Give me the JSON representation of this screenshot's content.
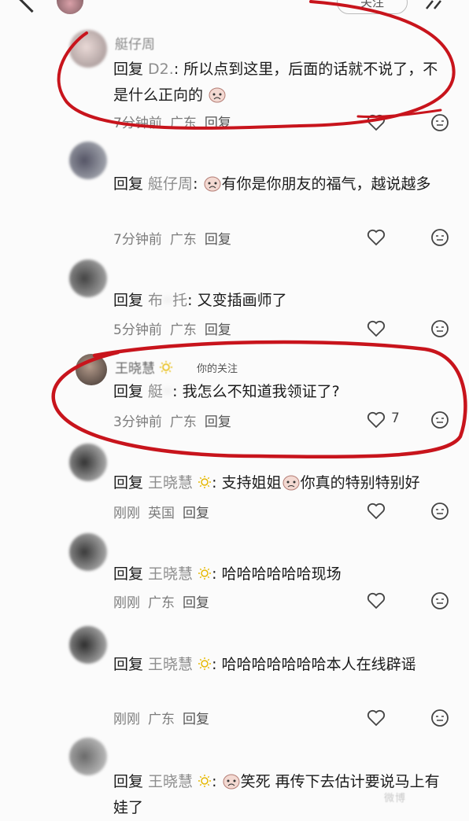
{
  "header": {
    "follow_label": "关注"
  },
  "comments": [
    {
      "username": "艇仔周",
      "text_prefix": "回复 ",
      "mention": "D2.",
      "colon": ": ",
      "body": "所以点到这里，后面的话就不说了，不是什么正向的",
      "time": "7分钟前",
      "location": "广东",
      "reply": "回复"
    },
    {
      "username": "",
      "text_prefix": "回复 ",
      "mention": "艇仔周",
      "colon": ": ",
      "body": "有你是你朋友的福气，越说越多",
      "time": "7分钟前",
      "location": "广东",
      "reply": "回复"
    },
    {
      "username": "",
      "text_prefix": "回复 ",
      "mention": "布",
      "mention2": "托",
      "colon": ": ",
      "body": "又变插画师了",
      "time": "5分钟前",
      "location": "广东",
      "reply": "回复"
    },
    {
      "username": "王晓慧",
      "follow_tag": "你的关注",
      "text_prefix": "回复 ",
      "mention": "艇",
      "colon": ": ",
      "body": "我怎么不知道我领证了?",
      "time": "3分钟前",
      "location": "广东",
      "reply": "回复",
      "likes": "7"
    },
    {
      "username": "",
      "text_prefix": "回复 ",
      "mention": "王晓慧",
      "colon": ": ",
      "body_a": "支持姐姐",
      "body_b": "你真的特别特别好",
      "time": "刚刚",
      "location": "英国",
      "reply": "回复"
    },
    {
      "username": "",
      "text_prefix": "回复 ",
      "mention": "王晓慧",
      "colon": ": ",
      "body": "哈哈哈哈哈哈现场",
      "time": "刚刚",
      "location": "广东",
      "reply": "回复"
    },
    {
      "username": "",
      "text_prefix": "回复 ",
      "mention": "王晓慧",
      "colon": ": ",
      "body": "哈哈哈哈哈哈哈本人在线辟谣",
      "time": "刚刚",
      "location": "广东",
      "reply": "回复"
    },
    {
      "username": "",
      "text_prefix": "回复 ",
      "mention": "王晓慧",
      "colon": ": ",
      "body": "笑死 再传下去估计要说马上有娃了",
      "body_end": "有娃了"
    }
  ],
  "watermark": "微博",
  "colors": {
    "annotation_red": "#c8141c",
    "meta_gray": "#7c7c7c",
    "sun_yellow": "#e6b800"
  }
}
